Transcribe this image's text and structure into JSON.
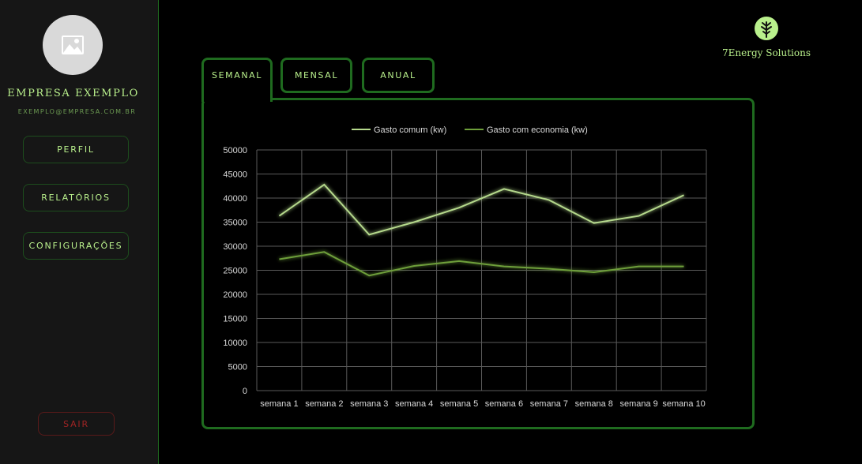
{
  "sidebar": {
    "company_name": "EMPRESA EXEMPLO",
    "email": "EXEMPLO@EMPRESA.COM.BR",
    "nav": [
      "PERFIL",
      "RELATÓRIOS",
      "CONFIGURAÇÕES"
    ],
    "logout": "SAIR"
  },
  "brand": {
    "name": "7Energy Solutions"
  },
  "tabs": [
    "SEMANAL",
    "MENSAL",
    "ANUAL"
  ],
  "colors": {
    "accent": "#1f6b1f",
    "text": "#b9f08c",
    "series1": "#b5d98c",
    "series2": "#6e9f3a",
    "danger": "#a12424"
  },
  "chart_data": {
    "type": "line",
    "categories": [
      "semana 1",
      "semana 2",
      "semana 3",
      "semana 4",
      "semana 5",
      "semana 6",
      "semana 7",
      "semana 8",
      "semana 9",
      "semana 10"
    ],
    "series": [
      {
        "name": "Gasto comum (kw)",
        "values": [
          36300,
          42800,
          32400,
          35000,
          38000,
          41900,
          39600,
          34800,
          36300,
          40600
        ]
      },
      {
        "name": "Gasto com economia (kw)",
        "values": [
          27300,
          28800,
          23900,
          25900,
          26900,
          25800,
          25300,
          24600,
          25800,
          25800
        ]
      }
    ],
    "ylim": [
      0,
      50000
    ],
    "yticks": [
      0,
      5000,
      10000,
      15000,
      20000,
      25000,
      30000,
      35000,
      40000,
      45000,
      50000
    ],
    "legend": "top",
    "grid": true
  }
}
